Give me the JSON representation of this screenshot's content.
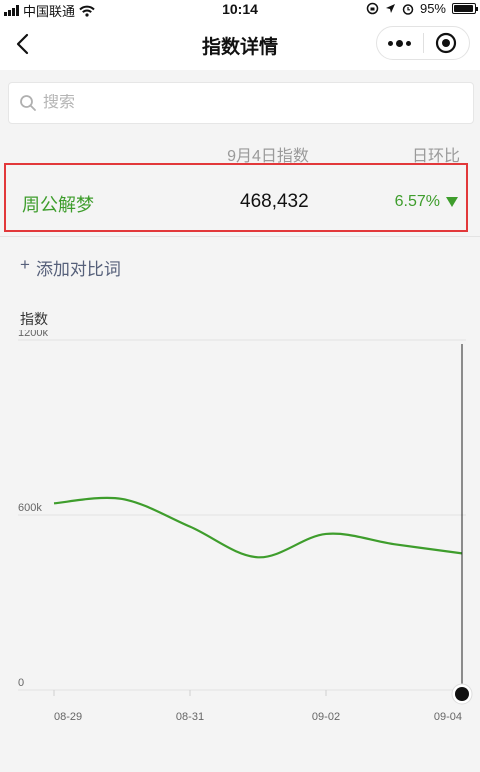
{
  "status_bar": {
    "carrier": "中国联通",
    "time": "10:14",
    "battery": "95%",
    "battery_level": 0.95
  },
  "nav": {
    "title": "指数详情",
    "icons": [
      "back-chevron-icon",
      "more-dots-icon",
      "target-circle-icon"
    ]
  },
  "search": {
    "placeholder": "搜索",
    "value": ""
  },
  "table": {
    "date_header": "9月4日指数",
    "change_header": "日环比",
    "row": {
      "keyword": "周公解梦",
      "value": "468,432",
      "change": "6.57%",
      "direction": "down"
    }
  },
  "add_compare": {
    "plus": "+",
    "label": "添加对比词"
  },
  "colors": {
    "accent_green": "#3e9d2c",
    "highlight_red": "#e2383a",
    "link_gray_blue": "#56607a"
  },
  "chart_data": {
    "type": "line",
    "ylabel": "指数",
    "yticks": [
      "1200k",
      "600k",
      "0"
    ],
    "ylim": [
      0,
      1200000
    ],
    "xticks": [
      "08-29",
      "08-31",
      "09-02",
      "09-04"
    ],
    "x": [
      "08-29",
      "08-30",
      "08-31",
      "09-01",
      "09-02",
      "09-03",
      "09-04"
    ],
    "series": [
      {
        "values": [
          640000,
          655000,
          560000,
          455000,
          535000,
          500000,
          468432
        ]
      }
    ],
    "grid": true,
    "selected_x": "09-04"
  }
}
